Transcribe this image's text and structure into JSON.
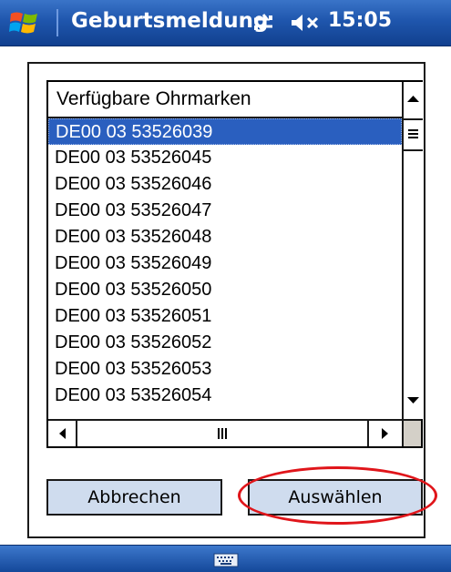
{
  "titlebar": {
    "title": "Geburtsmeldung",
    "clock": "15:05",
    "icons": [
      "windows-start-icon",
      "sync-icon",
      "volume-muted-icon"
    ]
  },
  "list": {
    "header": "Verfügbare Ohrmarken",
    "selected_index": 0,
    "items": [
      "DE00 03 53526039",
      "DE00 03 53526045",
      "DE00 03 53526046",
      "DE00 03 53526047",
      "DE00 03 53526048",
      "DE00 03 53526049",
      "DE00 03 53526050",
      "DE00 03 53526051",
      "DE00 03 53526052",
      "DE00 03 53526053",
      "DE00 03 53526054"
    ],
    "hscroll_thumb_glyph": "III"
  },
  "buttons": {
    "cancel_label": "Abbrechen",
    "select_label": "Auswählen"
  },
  "colors": {
    "titlebar": "#1f56ad",
    "selection": "#2a5fbf",
    "button_face": "#cfdcee",
    "annotation_circle": "#e0151a"
  },
  "bottombar": {
    "icons": [
      "keyboard-icon"
    ]
  }
}
